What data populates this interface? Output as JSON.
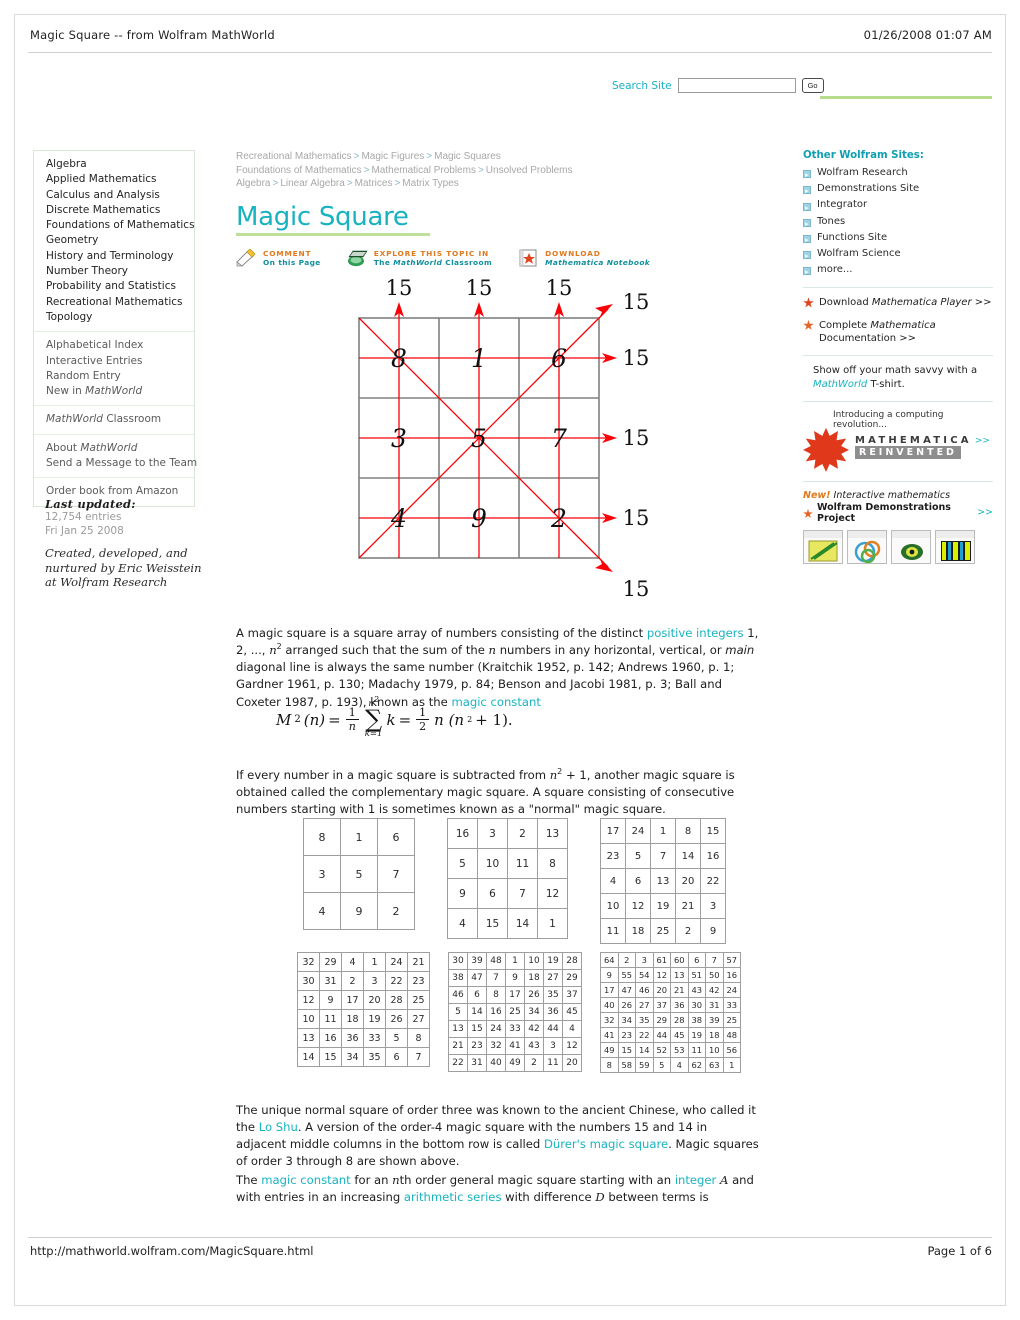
{
  "print": {
    "header_title": "Magic Square -- from Wolfram MathWorld",
    "header_date": "01/26/2008 01:07 AM",
    "footer_url": "http://mathworld.wolfram.com/MagicSquare.html",
    "footer_page": "Page 1 of 6"
  },
  "search": {
    "label": "Search Site",
    "value": "",
    "placeholder": "",
    "go_label": "Go"
  },
  "sidebar_left": {
    "topics": [
      "Algebra",
      "Applied Mathematics",
      "Calculus and Analysis",
      "Discrete Mathematics",
      "Foundations of Mathematics",
      "Geometry",
      "History and Terminology",
      "Number Theory",
      "Probability and Statistics",
      "Recreational Mathematics",
      "Topology"
    ],
    "utility": [
      "Alphabetical Index",
      "Interactive Entries",
      "Random Entry",
      "New in MathWorld"
    ],
    "classroom": "MathWorld Classroom",
    "about": [
      "About MathWorld",
      "Send a Message to the Team"
    ],
    "order": "Order book from Amazon",
    "last_updated_label": "Last updated:",
    "last_updated_entries": "12,754 entries",
    "last_updated_date": "Fri Jan 25 2008",
    "credit_line1": "Created, developed, and",
    "credit_line2": "nurtured by Eric Weisstein",
    "credit_line3": "at Wolfram Research"
  },
  "breadcrumbs": [
    [
      "Recreational Mathematics",
      "Magic Figures",
      "Magic Squares"
    ],
    [
      "Foundations of Mathematics",
      "Mathematical Problems",
      "Unsolved Problems"
    ],
    [
      "Algebra",
      "Linear Algebra",
      "Matrices",
      "Matrix Types"
    ]
  ],
  "page_title": "Magic Square",
  "actions": [
    {
      "icon": "comment-pencil-icon",
      "line1": "COMMENT",
      "line2": "On this Page"
    },
    {
      "icon": "classroom-book-icon",
      "line1": "EXPLORE THIS TOPIC IN",
      "line2": "The MathWorld Classroom"
    },
    {
      "icon": "notebook-download-icon",
      "line1": "DOWNLOAD",
      "line2": "Mathematica Notebook"
    }
  ],
  "figure": {
    "caption_value": "15",
    "grid": [
      [
        8,
        1,
        6
      ],
      [
        3,
        5,
        7
      ],
      [
        4,
        9,
        2
      ]
    ],
    "sums": {
      "columns": [
        "15",
        "15",
        "15"
      ],
      "rows": [
        "15",
        "15",
        "15"
      ],
      "diagonal_up": "15",
      "diagonal_down": "15"
    },
    "line_color": "#fb0007",
    "grid_color": "#808080"
  },
  "paragraphs": {
    "p1_a": "A magic square is a square array of numbers consisting of the distinct ",
    "p1_link1": "positive integers",
    "p1_b": " 1, 2, ..., ",
    "p1_n2": "n",
    "p1_c": " arranged such that the sum of the ",
    "p1_n": "n",
    "p1_d": " numbers in any horizontal, vertical, or ",
    "p1_main": "main",
    "p1_e": " diagonal line is always the same number (Kraitchik 1952, p. 142; Andrews 1960, p. 1; Gardner 1961, p. 130; Madachy 1979, p. 84; Benson and Jacobi 1981, p. 3; Ball and Coxeter 1987, p. 193), known as the ",
    "p1_link2": "magic constant",
    "p2_a": "If every number in a magic square is subtracted from ",
    "p2_expr": "n",
    "p2_b": " + 1, another magic square is obtained called the complementary magic square. A square consisting of consecutive numbers starting with 1 is sometimes known as a \"normal\" magic square.",
    "p3_a": "The unique normal square of order three was known to the ancient Chinese, who called it the ",
    "p3_link1": "Lo Shu",
    "p3_b": ". A version of the order-4 magic square with the numbers 15 and 14 in adjacent middle columns in the bottom row is called ",
    "p3_link2": "Dürer's magic square",
    "p3_c": ". Magic squares of order 3 through 8 are shown above.",
    "p4_a": "The ",
    "p4_link1": "magic constant",
    "p4_b": " for an ",
    "p4_n": "n",
    "p4_c": "th order general magic square starting with an ",
    "p4_link2": "integer",
    "p4_A": "A",
    "p4_d": " and with entries in an increasing ",
    "p4_link3": "arithmetic series",
    "p4_e": " with difference ",
    "p4_D": "D",
    "p4_f": " between terms is"
  },
  "formula": {
    "lhs": "M",
    "lhs_sub": "2",
    "lhs_arg": "(n)",
    "eq": "=",
    "frac1_num": "1",
    "frac1_den": "n",
    "sum_top": "n",
    "sum_top_exp": "2",
    "sum_bottom": "k=1",
    "summand": "k",
    "eq2": "=",
    "frac2_num": "1",
    "frac2_den": "2",
    "tail": "n (n",
    "tail_exp": "2",
    "tail_end": " + 1)."
  },
  "magic_squares": {
    "order3": [
      [
        8,
        1,
        6
      ],
      [
        3,
        5,
        7
      ],
      [
        4,
        9,
        2
      ]
    ],
    "order4": [
      [
        16,
        3,
        2,
        13
      ],
      [
        5,
        10,
        11,
        8
      ],
      [
        9,
        6,
        7,
        12
      ],
      [
        4,
        15,
        14,
        1
      ]
    ],
    "order5": [
      [
        17,
        24,
        1,
        8,
        15
      ],
      [
        23,
        5,
        7,
        14,
        16
      ],
      [
        4,
        6,
        13,
        20,
        22
      ],
      [
        10,
        12,
        19,
        21,
        3
      ],
      [
        11,
        18,
        25,
        2,
        9
      ]
    ],
    "order6": [
      [
        32,
        29,
        4,
        1,
        24,
        21
      ],
      [
        30,
        31,
        2,
        3,
        22,
        23
      ],
      [
        12,
        9,
        17,
        20,
        28,
        25
      ],
      [
        10,
        11,
        18,
        19,
        26,
        27
      ],
      [
        13,
        16,
        36,
        33,
        5,
        8
      ],
      [
        14,
        15,
        34,
        35,
        6,
        7
      ]
    ],
    "order7": [
      [
        30,
        39,
        48,
        1,
        10,
        19,
        28
      ],
      [
        38,
        47,
        7,
        9,
        18,
        27,
        29
      ],
      [
        46,
        6,
        8,
        17,
        26,
        35,
        37
      ],
      [
        5,
        14,
        16,
        25,
        34,
        36,
        45
      ],
      [
        13,
        15,
        24,
        33,
        42,
        44,
        4
      ],
      [
        21,
        23,
        32,
        41,
        43,
        3,
        12
      ],
      [
        22,
        31,
        40,
        49,
        2,
        11,
        20
      ]
    ],
    "order8": [
      [
        64,
        2,
        3,
        61,
        60,
        6,
        7,
        57
      ],
      [
        9,
        55,
        54,
        12,
        13,
        51,
        50,
        16
      ],
      [
        17,
        47,
        46,
        20,
        21,
        43,
        42,
        24
      ],
      [
        40,
        26,
        27,
        37,
        36,
        30,
        31,
        33
      ],
      [
        32,
        34,
        35,
        29,
        28,
        38,
        39,
        25
      ],
      [
        41,
        23,
        22,
        44,
        45,
        19,
        18,
        48
      ],
      [
        49,
        15,
        14,
        52,
        53,
        11,
        10,
        56
      ],
      [
        8,
        58,
        59,
        5,
        4,
        62,
        63,
        1
      ]
    ]
  },
  "sidebar_right": {
    "heading": "Other Wolfram Sites:",
    "sites": [
      "Wolfram Research",
      "Demonstrations Site",
      "Integrator",
      "Tones",
      "Functions Site",
      "Wolfram Science",
      "more..."
    ],
    "download_player": "Download Mathematica Player >>",
    "complete_doc_1": "Complete Mathematica",
    "complete_doc_2": "Documentation >>",
    "tshirt_1": "Show off your math savvy with a",
    "tshirt_link": "MathWorld",
    "tshirt_2": " T-shirt.",
    "promo_tag": "Introducing a computing revolution...",
    "promo_word1": "MATHEMATICA",
    "promo_word2": "REINVENTED",
    "promo_more": ">>",
    "demo_new": "New!",
    "demo_italic": "Interactive mathematics",
    "demo_title": "Wolfram Demonstrations Project",
    "demo_more": ">>"
  },
  "colors": {
    "accent_teal": "#19b3c1",
    "accent_green": "#bfe09a",
    "orange": "#e07a1f",
    "red": "#fb0007"
  }
}
